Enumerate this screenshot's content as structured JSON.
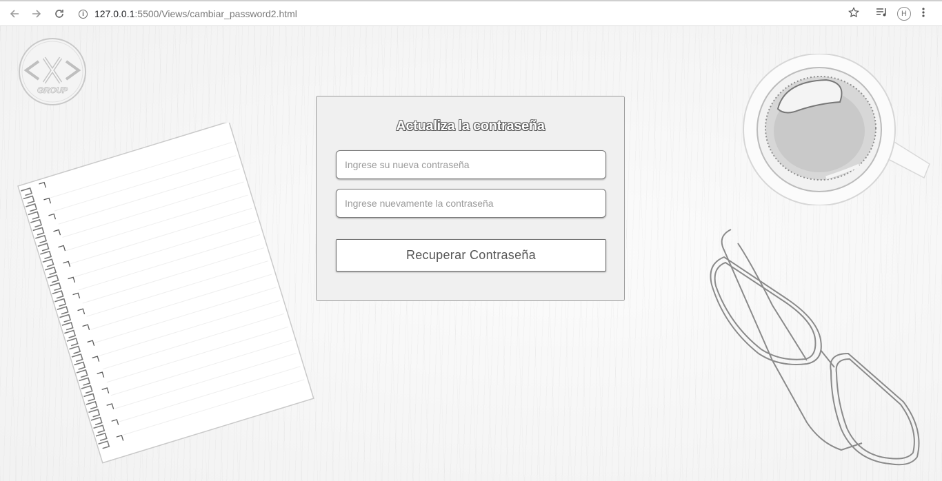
{
  "browser": {
    "url_host": "127.0.0.1",
    "url_path": ":5500/Views/cambiar_password2.html",
    "back_icon": "arrow-left-icon",
    "forward_icon": "arrow-right-icon",
    "reload_icon": "reload-icon",
    "profile_initial": "H"
  },
  "logo": {
    "text": "GROUP"
  },
  "form": {
    "title": "Actualiza la contraseña",
    "new_password_placeholder": "Ingrese su nueva contraseña",
    "confirm_password_placeholder": "Ingrese nuevamente la contraseña",
    "submit_label": "Recuperar Contraseña"
  }
}
